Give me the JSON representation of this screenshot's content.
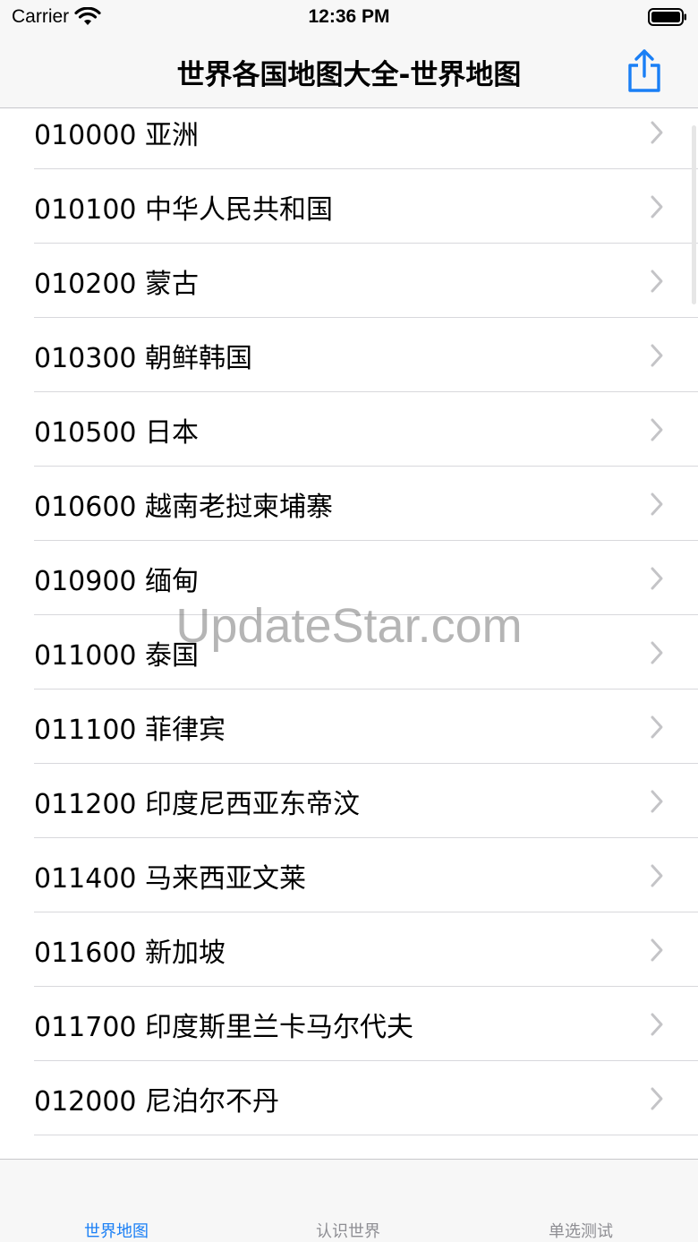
{
  "status_bar": {
    "carrier": "Carrier",
    "time": "12:36 PM"
  },
  "nav": {
    "title": "世界各国地图大全-世界地图",
    "share_icon": "share-icon",
    "accent_color": "#1a7ff5"
  },
  "list": {
    "items": [
      {
        "label": "010000 亚洲"
      },
      {
        "label": "010100 中华人民共和国"
      },
      {
        "label": "010200 蒙古"
      },
      {
        "label": "010300 朝鲜韩国"
      },
      {
        "label": "010500 日本"
      },
      {
        "label": "010600 越南老挝柬埔寨"
      },
      {
        "label": "010900 缅甸"
      },
      {
        "label": "011000 泰国"
      },
      {
        "label": "011100 菲律宾"
      },
      {
        "label": "011200 印度尼西亚东帝汶"
      },
      {
        "label": "011400 马来西亚文莱"
      },
      {
        "label": "011600 新加坡"
      },
      {
        "label": "011700 印度斯里兰卡马尔代夫"
      },
      {
        "label": "012000 尼泊尔不丹"
      }
    ]
  },
  "watermark": "UpdateStar.com",
  "tabs": [
    {
      "label": "世界地图",
      "active": true
    },
    {
      "label": "认识世界",
      "active": false
    },
    {
      "label": "单选测试",
      "active": false
    }
  ]
}
